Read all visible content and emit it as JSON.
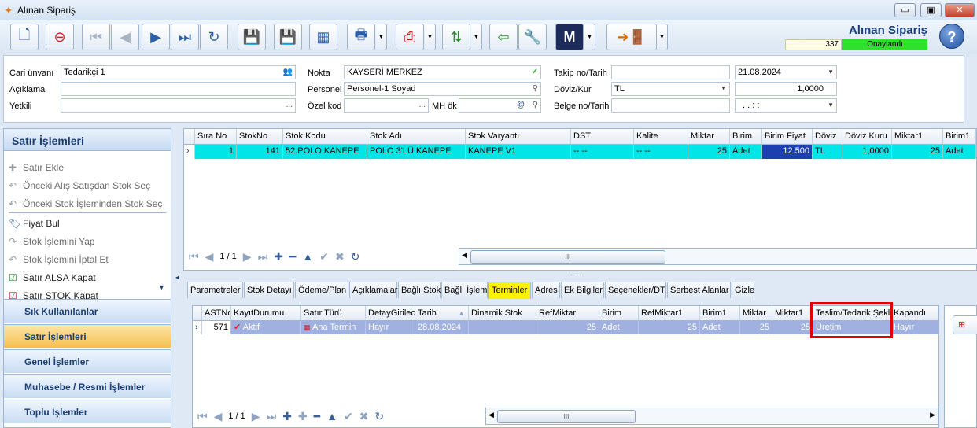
{
  "window": {
    "title": "Alınan Sipariş",
    "min": "▭",
    "max": "▣",
    "close": "✕"
  },
  "header_right": {
    "title": "Alınan Sipariş",
    "doc_no": "337",
    "status": "Onaylandı",
    "status_color": "#2fe02f",
    "help": "?"
  },
  "form": {
    "cari_label": "Cari ünvanı",
    "cari_value": "Tedarikçi 1",
    "aciklama_label": "Açıklama",
    "aciklama_value": "",
    "yetkili_label": "Yetkili",
    "yetkili_value": "",
    "nokta_label": "Nokta",
    "nokta_value": "KAYSERİ MERKEZ",
    "personel_label": "Personel",
    "personel_value": "Personel-1 Soyad",
    "ozelkod_label": "Özel kod",
    "ozelkod_value": "",
    "mhok_label": "MH ök",
    "mhok_value": "",
    "takip_label": "Takip no/Tarih",
    "takip_value": "",
    "takip_date": "21.08.2024",
    "doviz_label": "Döviz/Kur",
    "doviz_value": "TL",
    "kur_value": "1,0000",
    "belge_label": "Belge no/Tarih",
    "belge_value": "",
    "belge_date": ".  .    :  :",
    "dots": "...",
    "at": "@"
  },
  "sidebar": {
    "title": "Satır İşlemleri",
    "items": [
      {
        "label": "Satır Ekle",
        "icon": "plus-icon",
        "enabled": false
      },
      {
        "label": "Önceki Alış Satışdan Stok Seç",
        "icon": "undo-icon",
        "enabled": false
      },
      {
        "label": "Önceki Stok İşleminden Stok Seç",
        "icon": "undo-icon",
        "enabled": false
      },
      {
        "label": "Fiyat Bul",
        "icon": "price-tag-icon",
        "enabled": true
      },
      {
        "label": "Stok İşlemini Yap",
        "icon": "forward-icon",
        "enabled": false
      },
      {
        "label": "Stok İşlemini İptal Et",
        "icon": "undo-icon",
        "enabled": false
      },
      {
        "label": "Satır ALSA Kapat",
        "icon": "checklist-icon",
        "enabled": true
      },
      {
        "label": "Satır STOK Kapat",
        "icon": "checklist-icon",
        "enabled": true
      }
    ],
    "sections": [
      "Sık Kullanılanlar",
      "Satır İşlemleri",
      "Genel İşlemler",
      "Muhasebe / Resmi İşlemler",
      "Toplu İşlemler"
    ],
    "active_section": "Satır İşlemleri"
  },
  "grid1": {
    "columns": [
      "Sıra No",
      "StokNo",
      "Stok Kodu",
      "Stok Adı",
      "Stok Varyantı",
      "DST",
      "Kalite",
      "Miktar",
      "Birim",
      "Birim Fiyat",
      "Döviz",
      "Döviz Kuru",
      "Miktar1",
      "Birim1"
    ],
    "row": [
      "1",
      "141",
      "52.POLO.KANEPE",
      "POLO 3'LÜ KANEPE",
      "KANEPE V1",
      "-- --",
      "-- --",
      "25",
      "Adet",
      "12.500",
      "TL",
      "1,0000",
      "25",
      "Adet"
    ],
    "page": "1 / 1"
  },
  "tabs": [
    "Parametreler",
    "Stok Detayı",
    "Ödeme/Plan",
    "Açıklamalar",
    "Bağlı Stok",
    "Bağlı İşlem",
    "Terminler",
    "Adres",
    "Ek Bilgiler",
    "Seçenekler/DT",
    "Serbest Alanlar",
    "Gizle"
  ],
  "active_tab": "Terminler",
  "grid2": {
    "columns": [
      "ASTNo",
      "KayıtDurumu",
      "Satır Türü",
      "DetayGirilec",
      "Tarih",
      "Dinamik Stok",
      "RefMiktar",
      "Birim",
      "RefMiktar1",
      "Birim1",
      "Miktar",
      "Miktar1",
      "Teslim/Tedarik Şekli",
      "Kapandı"
    ],
    "row": [
      "571",
      "Aktif",
      "Ana Termin",
      "Hayır",
      "28.08.2024",
      "",
      "25",
      "Adet",
      "25",
      "Adet",
      "25",
      "25",
      "Üretim",
      "Hayır"
    ],
    "page": "1 / 1"
  },
  "scroll_grip": "III"
}
